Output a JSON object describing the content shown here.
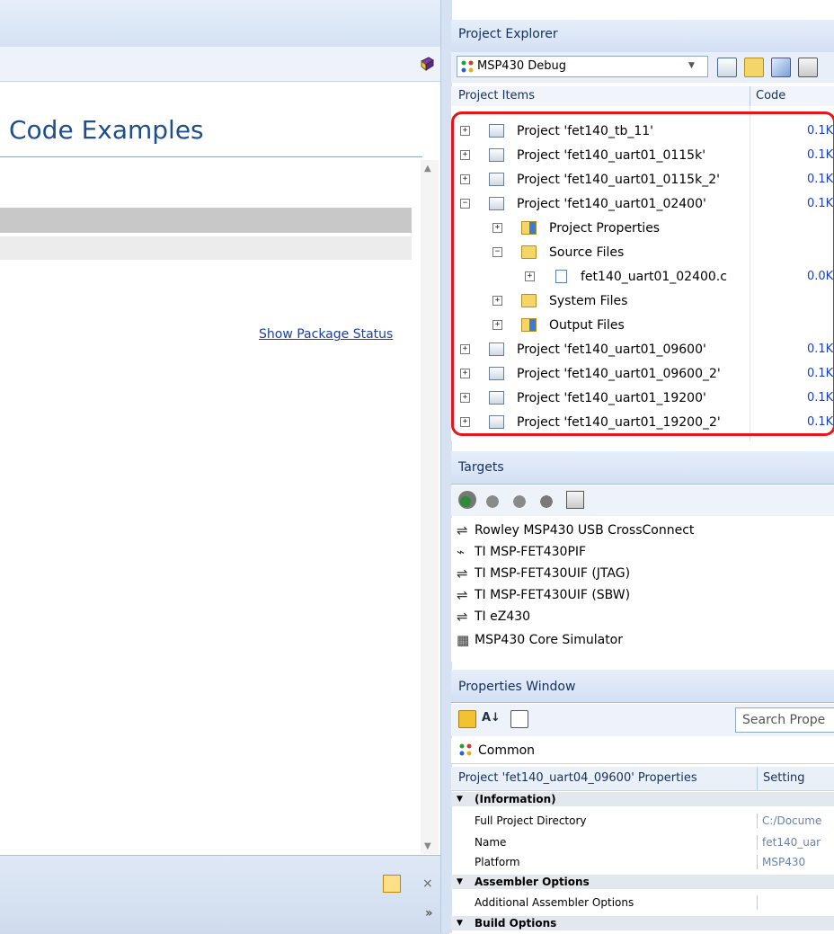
{
  "left_panel": {
    "heading": "Code Examples",
    "link_show_package_status": "Show Package Status",
    "close_symbol": "×",
    "more_symbol": "»"
  },
  "project_explorer": {
    "title": "Project Explorer",
    "config": "MSP430 Debug",
    "columns": [
      "Project Items",
      "Code"
    ],
    "tree": [
      {
        "label": "Project 'fet140_tb_11'",
        "code": "0.1K",
        "level": 0,
        "expanded": false,
        "icon": "project-icon"
      },
      {
        "label": "Project 'fet140_uart01_0115k'",
        "code": "0.1K",
        "level": 0,
        "expanded": false,
        "icon": "project-icon"
      },
      {
        "label": "Project 'fet140_uart01_0115k_2'",
        "code": "0.1K",
        "level": 0,
        "expanded": false,
        "icon": "project-icon"
      },
      {
        "label": "Project 'fet140_uart01_02400'",
        "code": "0.1K",
        "level": 0,
        "expanded": true,
        "icon": "project-icon"
      },
      {
        "label": "Project Properties",
        "code": "",
        "level": 1,
        "expanded": false,
        "icon": "properties-folder-icon"
      },
      {
        "label": "Source Files",
        "code": "",
        "level": 1,
        "expanded": true,
        "icon": "folder-open-icon"
      },
      {
        "label": "fet140_uart01_02400.c",
        "code": "0.0K",
        "level": 2,
        "expanded": false,
        "icon": "c-file-icon"
      },
      {
        "label": "System Files",
        "code": "",
        "level": 1,
        "expanded": false,
        "icon": "folder-icon"
      },
      {
        "label": "Output Files",
        "code": "",
        "level": 1,
        "expanded": false,
        "icon": "output-folder-icon"
      },
      {
        "label": "Project 'fet140_uart01_09600'",
        "code": "0.1K",
        "level": 0,
        "expanded": false,
        "icon": "project-icon"
      },
      {
        "label": "Project 'fet140_uart01_09600_2'",
        "code": "0.1K",
        "level": 0,
        "expanded": false,
        "icon": "project-icon"
      },
      {
        "label": "Project 'fet140_uart01_19200'",
        "code": "0.1K",
        "level": 0,
        "expanded": false,
        "icon": "project-icon"
      },
      {
        "label": "Project 'fet140_uart01_19200_2'",
        "code": "0.1K",
        "level": 0,
        "expanded": false,
        "icon": "project-icon"
      }
    ]
  },
  "targets": {
    "title": "Targets",
    "items": [
      {
        "label": "Rowley MSP430 USB CrossConnect",
        "icon": "usb-icon"
      },
      {
        "label": "TI MSP-FET430PIF",
        "icon": "parallel-port-icon"
      },
      {
        "label": "TI MSP-FET430UIF (JTAG)",
        "icon": "usb-icon"
      },
      {
        "label": "TI MSP-FET430UIF (SBW)",
        "icon": "usb-icon"
      },
      {
        "label": "TI eZ430",
        "icon": "usb-icon"
      },
      {
        "label": "MSP430 Core Simulator",
        "icon": "chip-icon"
      }
    ]
  },
  "properties": {
    "title": "Properties Window",
    "search_placeholder": "Search Prope",
    "common": "Common",
    "columns": [
      "Project 'fet140_uart04_09600' Properties",
      "Setting"
    ],
    "rows": [
      {
        "type": "category",
        "label": "(Information)"
      },
      {
        "type": "item",
        "name": "Full Project Directory",
        "value": "C:/Docume"
      },
      {
        "type": "item",
        "name": "Name",
        "value": "fet140_uar"
      },
      {
        "type": "item",
        "name": "Platform",
        "value": "MSP430"
      },
      {
        "type": "category",
        "label": "Assembler Options"
      },
      {
        "type": "item",
        "name": "Additional Assembler Options",
        "value": ""
      },
      {
        "type": "category",
        "label": "Build Options"
      }
    ]
  },
  "colors": {
    "highlight": "#e8141a",
    "link": "#1a3fa8",
    "heading": "#1f4e8c",
    "code_size": "#1a3fbf"
  }
}
